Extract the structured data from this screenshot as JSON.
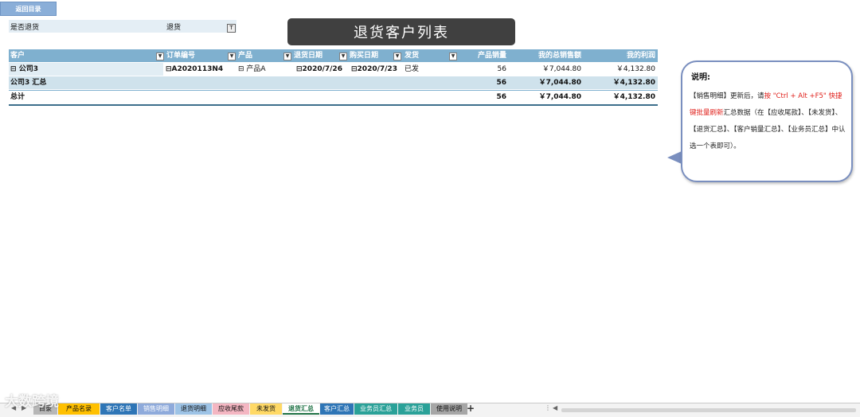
{
  "back_button": "返回目录",
  "filter": {
    "label": "是否退货",
    "value": "退货",
    "icon": "filter-icon"
  },
  "title": "退货客户列表",
  "headers": {
    "customer": "客户",
    "order_no": "订单编号",
    "product": "产品",
    "return_date": "退货日期",
    "purchase_date": "购买日期",
    "shipping": "发货",
    "qty": "产品销量",
    "total_sales": "我的总销售额",
    "profit": "我的利润"
  },
  "rows": {
    "detail": {
      "customer": "公司3",
      "order_no": "A2020113N4",
      "product": "产品A",
      "return_date": "2020/7/26",
      "purchase_date": "2020/7/23",
      "shipping": "已发",
      "qty": "56",
      "total_sales": "￥7,044.80",
      "profit": "￥4,132.80"
    },
    "subtotal": {
      "label": "公司3 汇总",
      "qty": "56",
      "total_sales": "￥7,044.80",
      "profit": "￥4,132.80"
    },
    "grand_total": {
      "label": "总计",
      "qty": "56",
      "total_sales": "￥7,044.80",
      "profit": "￥4,132.80"
    }
  },
  "note": {
    "title": "说明:",
    "p1": "【销售明细】更新后，请",
    "p1_red": "按 \"Ctrl + Alt +F5\" 快捷键批量刷新",
    "p1_rest": "汇总数据（在【应收尾款】、【未发货】、【退货汇总】、【客户销量汇总】、【业务员汇总】中认选一个表即可）。"
  },
  "tabs": [
    {
      "label": "目录",
      "color": "#b7b7b7"
    },
    {
      "label": "产品名录",
      "color": "#ffc000"
    },
    {
      "label": "客户名单",
      "color": "#2e75b6"
    },
    {
      "label": "销售明细",
      "color": "#8eaadb"
    },
    {
      "label": "退货明细",
      "color": "#9dc3e6"
    },
    {
      "label": "应收尾款",
      "color": "#f4b6c2"
    },
    {
      "label": "未发货",
      "color": "#ffd966"
    },
    {
      "label": "退货汇总",
      "color": "#ffffff"
    },
    {
      "label": "客户汇总",
      "color": "#2e75b6"
    },
    {
      "label": "业务员汇总",
      "color": "#2aa198"
    },
    {
      "label": "业务员",
      "color": "#2aa198"
    },
    {
      "label": "使用说明",
      "color": "#a6a6a6"
    }
  ],
  "add_sheet": "+",
  "watermark": "大数跨境"
}
